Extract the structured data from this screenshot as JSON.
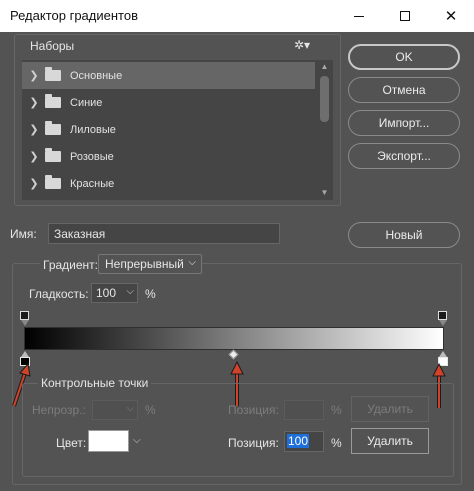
{
  "window": {
    "title": "Редактор градиентов"
  },
  "presets": {
    "title": "Наборы",
    "items": [
      {
        "label": "Основные",
        "selected": true
      },
      {
        "label": "Синие",
        "selected": false
      },
      {
        "label": "Лиловые",
        "selected": false
      },
      {
        "label": "Розовые",
        "selected": false
      },
      {
        "label": "Красные",
        "selected": false
      }
    ]
  },
  "buttons": {
    "ok": "OK",
    "cancel": "Отмена",
    "import": "Импорт...",
    "export": "Экспорт...",
    "new": "Новый"
  },
  "name": {
    "label": "Имя:",
    "value": "Заказная"
  },
  "gradient": {
    "type_label": "Градиент:",
    "type_value": "Непрерывный",
    "smoothness_label": "Гладкость:",
    "smoothness_value": "100",
    "smoothness_unit": "%",
    "start_color": "#000000",
    "end_color": "#ffffff",
    "midpoint_fraction": 0.5
  },
  "stops": {
    "title": "Контрольные точки",
    "opacity_label": "Непрозр.:",
    "opacity_value": "",
    "opacity_unit": "%",
    "opacity_position_label": "Позиция:",
    "opacity_position_value": "",
    "opacity_position_unit": "%",
    "opacity_delete": "Удалить",
    "color_label": "Цвет:",
    "color_value": "#ffffff",
    "color_position_label": "Позиция:",
    "color_position_value": "100",
    "color_position_unit": "%",
    "color_delete": "Удалить"
  }
}
